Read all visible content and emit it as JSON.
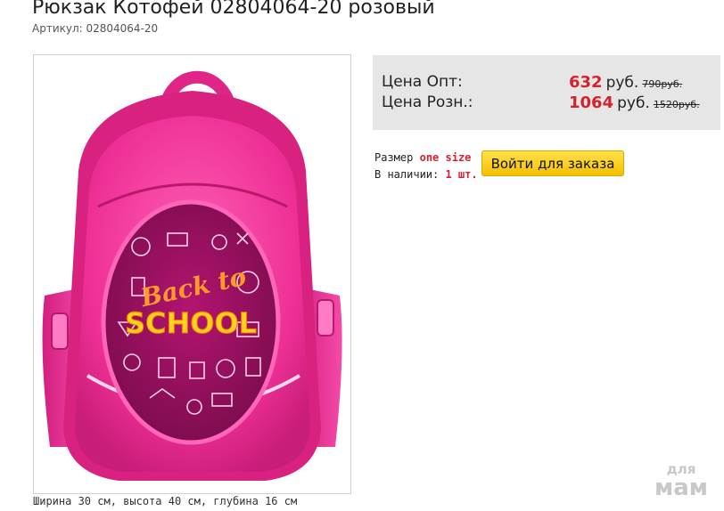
{
  "product": {
    "title": "Рюкзак Котофей 02804064-20 розовый",
    "sku": "Артикул: 02804064-20",
    "dimensions": "Ширина 30 см, высота 40 см, глубина 16 см",
    "image_text": {
      "line1": "Back to",
      "line2": "SCHOOL"
    }
  },
  "prices": {
    "wholesale_label": "Цена Опт:",
    "wholesale_value": "632",
    "wholesale_old": "790руб.",
    "retail_label": "Цена Розн.:",
    "retail_value": "1064",
    "retail_old": "1520руб.",
    "currency": "руб."
  },
  "info": {
    "size_label": "Размер",
    "size_value": "one size",
    "stock_label": "В наличии:",
    "stock_value": "1 шт."
  },
  "order_button": "Войти для заказа",
  "watermark": {
    "line1": "для",
    "line2": "мам"
  },
  "colors": {
    "accent_red": "#d6212f",
    "button_yellow": "#f4c000",
    "price_bg": "#e6e6e6",
    "backpack_pink": "#f0359a"
  }
}
